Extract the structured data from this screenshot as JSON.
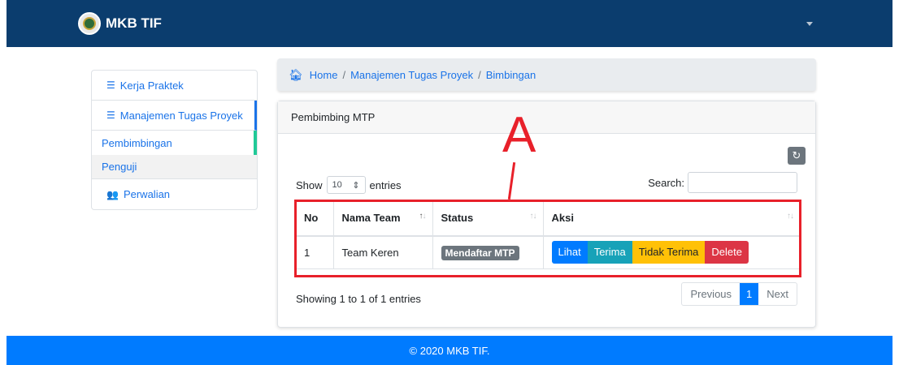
{
  "navbar": {
    "brand": "MKB TIF",
    "bg_color": "#0b3d6e"
  },
  "sidebar": {
    "items": [
      {
        "label": "Kerja Praktek",
        "icon": "tasks-icon"
      },
      {
        "label": "Manajemen Tugas Proyek",
        "icon": "tasks-icon"
      },
      {
        "label": "Pembimbingan"
      },
      {
        "label": "Penguji"
      },
      {
        "label": "Perwalian",
        "icon": "users-icon"
      }
    ]
  },
  "breadcrumb": {
    "home": "Home",
    "section": "Manajemen Tugas Proyek",
    "page": "Bimbingan",
    "separator": "/"
  },
  "card": {
    "title": "Pembimbing MTP",
    "show_label": "Show",
    "entries_value": "10",
    "entries_label": "entries",
    "search_label": "Search:",
    "search_value": "",
    "table": {
      "headers": [
        "No",
        "Nama Team",
        "Status",
        "Aksi"
      ],
      "rows": [
        {
          "no": "1",
          "team": "Team Keren",
          "status": "Mendaftar MTP"
        }
      ],
      "actions": {
        "view": "Lihat",
        "accept": "Terima",
        "reject": "Tidak Terima",
        "delete": "Delete"
      }
    },
    "info": "Showing 1 to 1 of 1 entries",
    "pagination": {
      "previous": "Previous",
      "current": "1",
      "next": "Next"
    }
  },
  "annotation": {
    "letter": "A",
    "color": "#e8202a"
  },
  "footer": {
    "text": "© 2020 MKB TIF.",
    "bg_color": "#007bff"
  }
}
